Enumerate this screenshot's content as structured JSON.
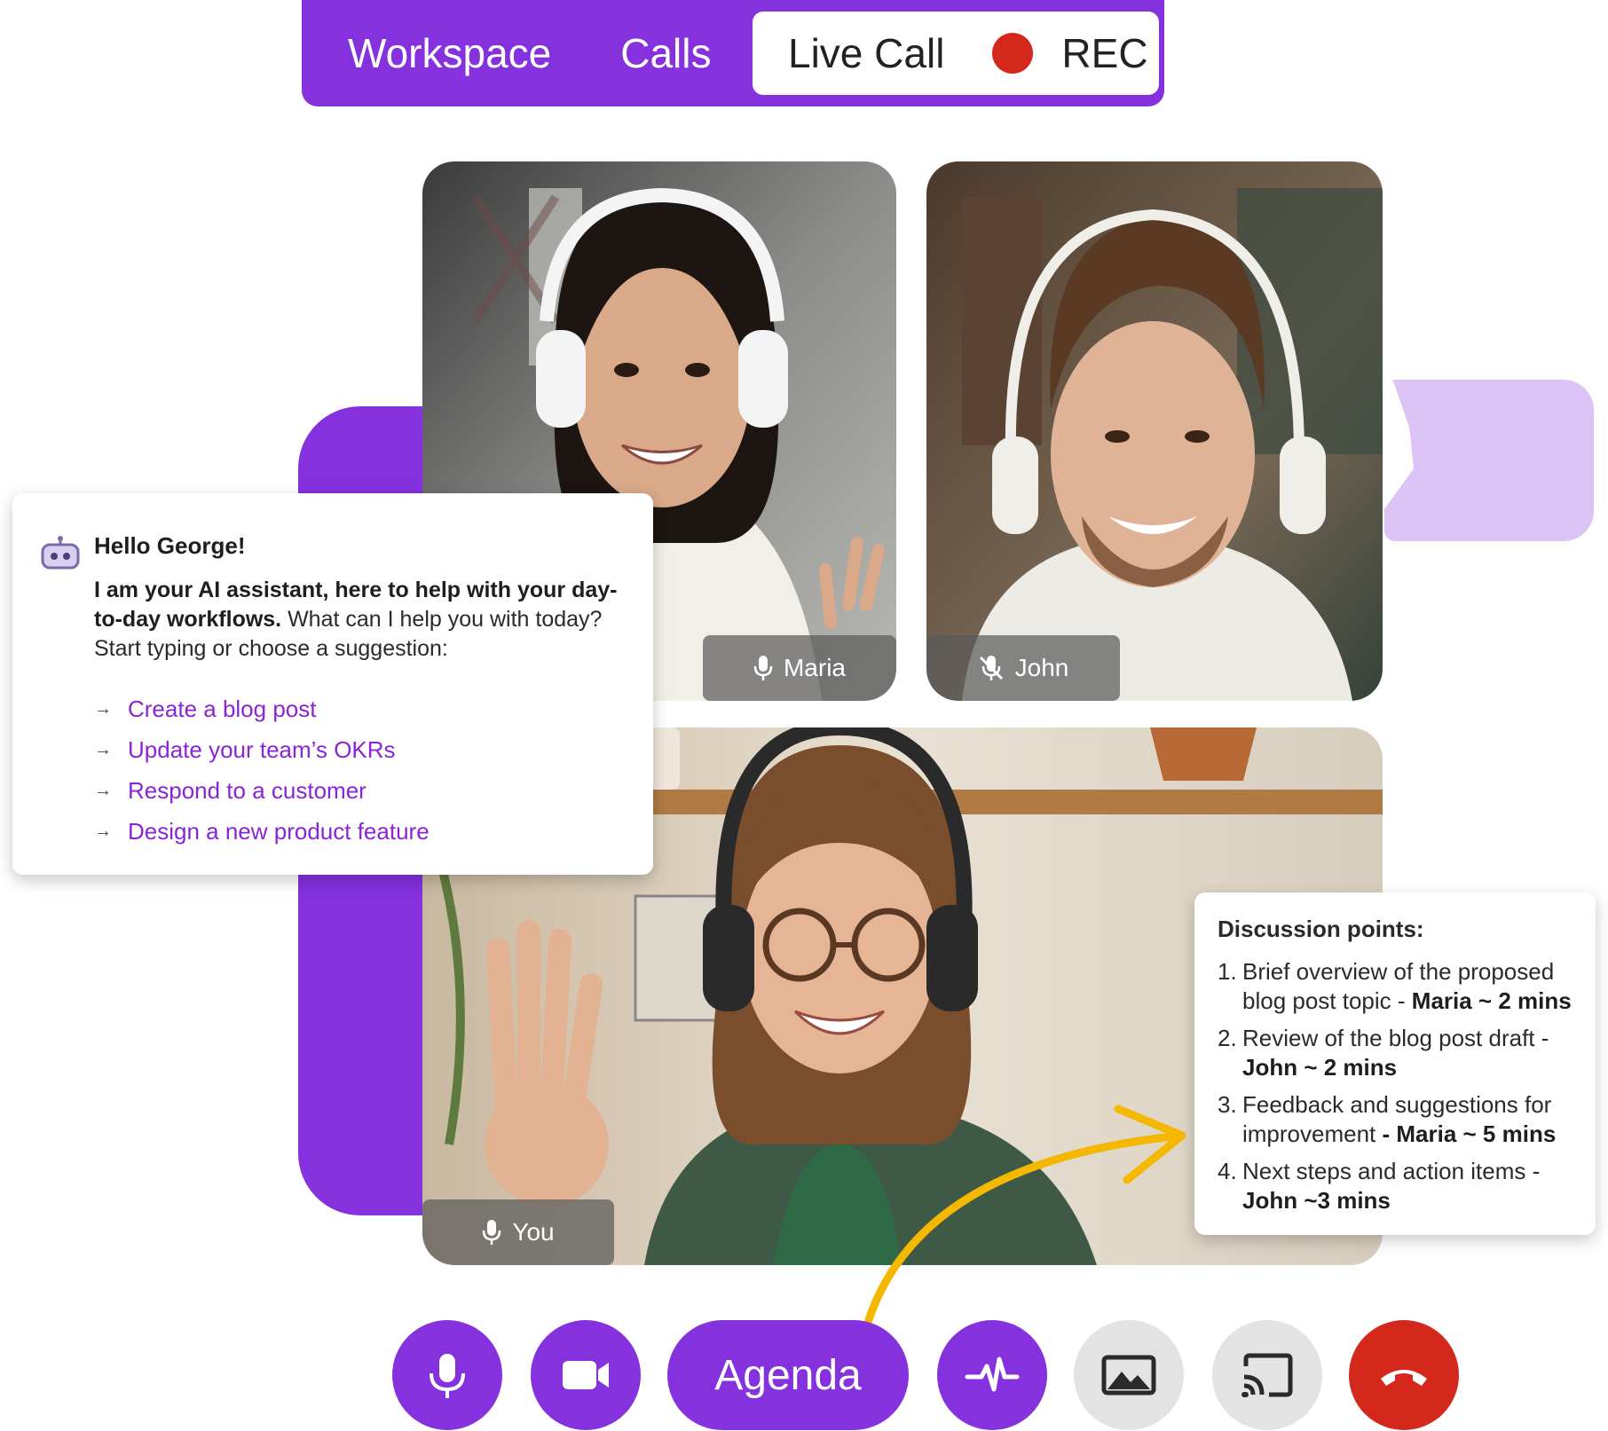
{
  "nav": {
    "tabs": [
      "Workspace",
      "Calls"
    ],
    "active_tab": "Live Call",
    "rec_label": "REC"
  },
  "participants": {
    "maria": "Maria",
    "john": "John",
    "you": "You"
  },
  "assistant": {
    "greeting": "Hello George!",
    "intro_bold": "I am your AI assistant, here to help with your day-to-day workflows.",
    "intro_rest": " What can I help you with today? Start typing or choose a suggestion:",
    "suggestions": [
      "Create a blog post",
      "Update your team’s OKRs",
      "Respond to a customer",
      "Design a new product feature"
    ]
  },
  "discussion": {
    "title": "Discussion points:",
    "items": [
      {
        "num": "1.",
        "text": "Brief overview of the proposed blog post topic - ",
        "who": "Maria ~ 2 mins"
      },
      {
        "num": "2.",
        "text": "Review of the blog post draft - ",
        "who": "John ~ 2 mins"
      },
      {
        "num": "3.",
        "text": "Feedback and suggestions for improvement ",
        "who": "- Maria ~ 5 mins"
      },
      {
        "num": "4.",
        "text": "Next steps and action items - ",
        "who": "John ~3 mins"
      }
    ]
  },
  "controls": {
    "agenda_label": "Agenda",
    "icons": [
      "microphone-icon",
      "video-camera-icon",
      "waveform-icon",
      "image-icon",
      "cast-icon",
      "end-call-icon"
    ]
  },
  "colors": {
    "brand_purple": "#8531de",
    "rec_red": "#d5281c",
    "link_purple": "#8a24d6",
    "accent_yellow": "#f5b800",
    "light_purple": "#dcc3f5"
  }
}
